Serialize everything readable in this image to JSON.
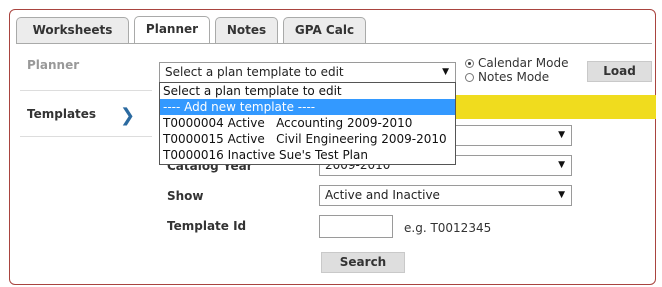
{
  "tabs": [
    {
      "label": "Worksheets"
    },
    {
      "label": "Planner"
    },
    {
      "label": "Notes"
    },
    {
      "label": "GPA Calc"
    }
  ],
  "sidebar": {
    "planner_label": "Planner",
    "templates_label": "Templates"
  },
  "planner": {
    "template_select_value": "Select a plan template to edit",
    "radio_calendar": "Calendar Mode",
    "radio_notes": "Notes Mode",
    "load_button": "Load"
  },
  "dropdown": {
    "options": [
      "Select a plan template to edit",
      "---- Add new template ----",
      "T0000004 Active   Accounting 2009-2010",
      "T0000015 Active   Civil Engineering 2009-2010",
      "T0000016 Inactive Sue's Test Plan"
    ],
    "highlighted_index": 1
  },
  "search_form": {
    "catalog_year_label": "Catalog Year",
    "catalog_year_value": "2009-2010",
    "show_label": "Show",
    "show_value": "Active and Inactive",
    "template_id_label": "Template Id",
    "template_id_value": "",
    "template_id_hint": "e.g. T0012345",
    "search_button": "Search"
  },
  "colors": {
    "frame_border": "#a9443f",
    "highlight_bar": "#f0dc1e",
    "selected_option": "#3399ff",
    "chevron": "#2b6aa0"
  }
}
